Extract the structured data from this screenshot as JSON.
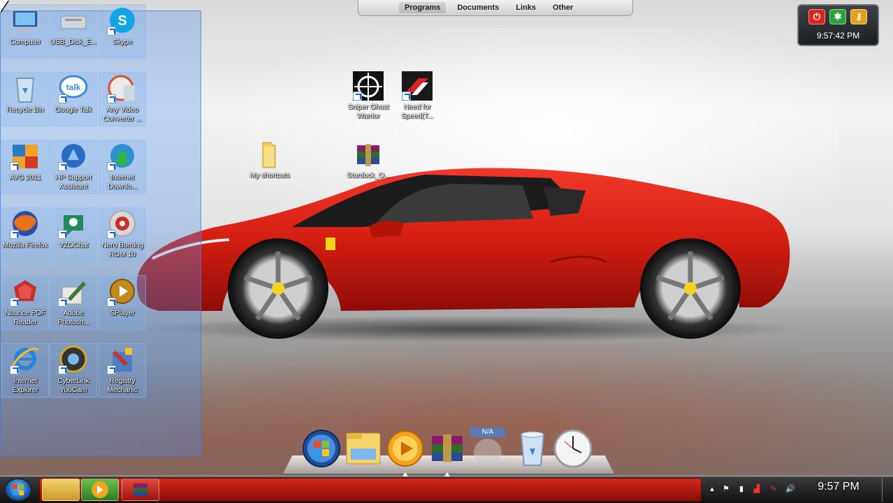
{
  "desktop": {
    "icons_left": [
      {
        "label": "Computer",
        "icon": "computer-icon"
      },
      {
        "label": "USB_Disk_E...",
        "icon": "usb-drive-icon"
      },
      {
        "label": "Skype",
        "icon": "skype-icon"
      },
      {
        "label": "Recycle Bin",
        "icon": "recycle-bin-icon"
      },
      {
        "label": "Google Talk",
        "icon": "google-talk-icon"
      },
      {
        "label": "Any Video Converter ...",
        "icon": "video-converter-icon"
      },
      {
        "label": "AVG 2011",
        "icon": "avg-icon"
      },
      {
        "label": "HP Support Assistant",
        "icon": "hp-support-icon"
      },
      {
        "label": "Internet Downlo...",
        "icon": "internet-download-icon"
      },
      {
        "label": "Mozilla Firefox",
        "icon": "firefox-icon"
      },
      {
        "label": "VZOChat",
        "icon": "vzochat-icon"
      },
      {
        "label": "Nero Burning ROM 10",
        "icon": "nero-icon"
      },
      {
        "label": "Nuance PDF Reader",
        "icon": "pdf-reader-icon"
      },
      {
        "label": "Adobe Photosh...",
        "icon": "photoshop-icon"
      },
      {
        "label": "SPlayer",
        "icon": "splayer-icon"
      },
      {
        "label": "Internet Explorer",
        "icon": "internet-explorer-icon"
      },
      {
        "label": "CyberLink YouCam",
        "icon": "youcam-icon"
      },
      {
        "label": "Registry Mechanic",
        "icon": "registry-mechanic-icon"
      }
    ],
    "icons_center": [
      {
        "label": "Sniper Ghost Warrior",
        "icon": "sniper-game-icon"
      },
      {
        "label": "Need for Speed(T...",
        "icon": "need-for-speed-icon"
      },
      {
        "label": "My shortcuts",
        "icon": "folder-icon"
      },
      {
        "label": "Stardock_O...",
        "icon": "winrar-archive-icon"
      }
    ]
  },
  "top_menu": {
    "tabs": [
      "Programs",
      "Documents",
      "Links",
      "Other"
    ],
    "active": "Programs"
  },
  "power_gadget": {
    "time": "9:57:42 PM"
  },
  "dock": {
    "items": [
      "start-orb-icon",
      "explorer-folder-icon",
      "media-player-icon",
      "winrar-icon",
      "blank-icon",
      "recycle-bin-icon",
      "clock-icon"
    ],
    "blank_label": "N/A"
  },
  "taskbar": {
    "clock": "9:57 PM",
    "tray_expand": "▴",
    "volume": "🔊"
  },
  "colors": {
    "taskbar_strip": "#c21d10",
    "car_red": "#d41e12",
    "selection": "#5091eb"
  }
}
